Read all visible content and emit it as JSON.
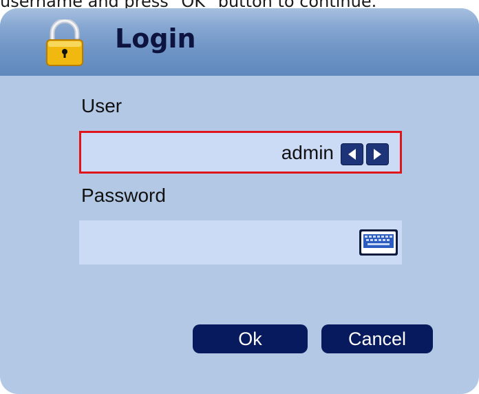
{
  "instruction": "username and press \"OK\" button to continue.",
  "dialog": {
    "title": "Login",
    "user": {
      "label": "User",
      "value": "admin"
    },
    "password": {
      "label": "Password",
      "value": ""
    },
    "buttons": {
      "ok": "Ok",
      "cancel": "Cancel"
    }
  },
  "colors": {
    "title_bar": "#6f95c6",
    "dialog_bg": "#b3c8e4",
    "field_bg": "#cbdbf5",
    "focus_border": "#e0141b",
    "button_bg": "#081a5e",
    "arrow_bg": "#1d3578"
  },
  "icons": {
    "title": "lock-icon",
    "user_prev": "arrow-left-icon",
    "user_next": "arrow-right-icon",
    "password_keyboard": "keyboard-icon"
  }
}
